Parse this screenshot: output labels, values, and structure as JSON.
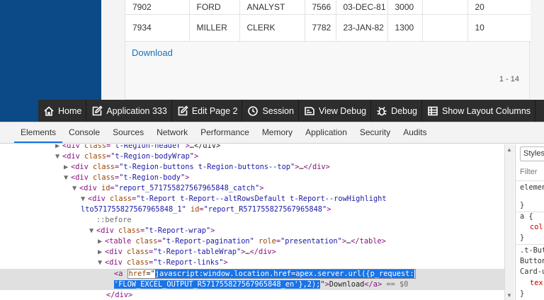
{
  "report": {
    "rows": [
      [
        "7902",
        "FORD",
        "ANALYST",
        "7566",
        "03-DEC-81",
        "3000",
        "",
        "20"
      ],
      [
        "7934",
        "MILLER",
        "CLERK",
        "7782",
        "23-JAN-82",
        "1300",
        "",
        "10"
      ]
    ],
    "download_label": "Download",
    "pagination": "1 - 14"
  },
  "devbar": {
    "items": [
      {
        "label": "Home",
        "icon": "home-icon"
      },
      {
        "label": "Application 333",
        "icon": "edit-app-icon"
      },
      {
        "label": "Edit Page 2",
        "icon": "edit-page-icon"
      },
      {
        "label": "Session",
        "icon": "session-icon"
      },
      {
        "label": "View Debug",
        "icon": "view-debug-icon"
      },
      {
        "label": "Debug",
        "icon": "bug-icon"
      },
      {
        "label": "Show Layout Columns",
        "icon": "grid-icon"
      }
    ]
  },
  "devtools": {
    "tabs": [
      "Elements",
      "Console",
      "Sources",
      "Network",
      "Performance",
      "Memory",
      "Application",
      "Security",
      "Audits"
    ],
    "active_tab": "Elements",
    "lines": {
      "l0_pre": "\"t-Region-header\"",
      "l0_post": "…</div>",
      "l1": "\"t-Region-bodyWrap\"",
      "l2": "\"t-Region-buttons t-Region-buttons--top\"",
      "l3": "\"t-Region-body\"",
      "l4": "\"report_571755827567965848_catch\"",
      "l5": "\"t-Report t-Report--altRowsDefault t-Report--rowHighlight",
      "l6a": "lto571755827567965848_1\"",
      "l6b": "\"report_R571755827567965848\"",
      "l7": "::before",
      "l8": "\"t-Report-wrap\"",
      "l9a": "\"t-Report-pagination\"",
      "l9b": "\"presentation\"",
      "l10": "\"t-Report-tableWrap\"",
      "l11": "\"t-Report-links\"",
      "sel_attr_value_1": "javascript:window.location.href=apex.server.url({p_request:",
      "sel_attr_value_2": "'FLOW_EXCEL_OUTPUT_R571755827567965848_en'},2);",
      "sel_text": "Download",
      "sel_suffix": " == $0"
    },
    "styles": {
      "tab_label": "Styles",
      "filter": "Filter",
      "lines": [
        "element",
        "}",
        "a {",
        "col",
        "}",
        ".t-But",
        "Button",
        "Card-u",
        "tex",
        "}"
      ]
    }
  },
  "colors": {
    "nav": "#0b4a86",
    "devbar": "#2d2d2d",
    "selection": "#1a73e8",
    "link": "#1770b8"
  }
}
